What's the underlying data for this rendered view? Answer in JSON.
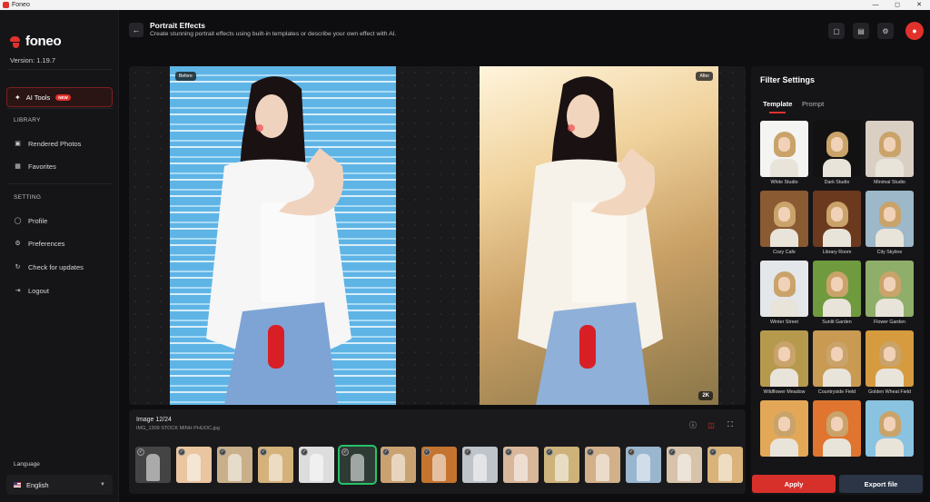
{
  "window": {
    "title": "Foneo"
  },
  "brand": {
    "name": "foneo",
    "version": "Version: 1.19.7",
    "accent": "#e0312c"
  },
  "sidebar": {
    "ai_tools": {
      "label": "AI Tools",
      "badge": "NEW",
      "icon": "magic-wand-icon"
    },
    "library_label": "LIBRARY",
    "library_items": [
      {
        "label": "Rendered Photos",
        "icon": "image-icon"
      },
      {
        "label": "Favorites",
        "icon": "grid-icon"
      }
    ],
    "setting_label": "SETTING",
    "setting_items": [
      {
        "label": "Profile",
        "icon": "user-circle-icon"
      },
      {
        "label": "Preferences",
        "icon": "gear-icon"
      },
      {
        "label": "Check for updates",
        "icon": "refresh-icon"
      },
      {
        "label": "Logout",
        "icon": "logout-icon"
      }
    ],
    "language_label": "Language",
    "language_value": "English"
  },
  "header": {
    "title": "Portrait Effects",
    "subtitle": "Create stunning portrait effects using built-in templates or describe your own effect with AI.",
    "icons": [
      "chat-icon",
      "file-icon",
      "settings-icon",
      "user-icon"
    ]
  },
  "preview": {
    "before_label": "Before",
    "after_label": "After",
    "resolution": "2K"
  },
  "strip": {
    "title": "Image 12/24",
    "filename": "IMG_1309 STOCK MINH PHUOC.jpg",
    "icons": [
      "info-icon",
      "compare-icon",
      "fullscreen-icon"
    ],
    "selected_index": 5,
    "thumbs": 15
  },
  "panel": {
    "title": "Filter Settings",
    "tabs": [
      "Template",
      "Prompt"
    ],
    "active_tab": "Template",
    "templates": [
      {
        "label": "White Studio",
        "bg": "#f4f4f2"
      },
      {
        "label": "Dark Studio",
        "bg": "#121212"
      },
      {
        "label": "Minimal Studio",
        "bg": "#d9cfc3"
      },
      {
        "label": "Cozy Cafe",
        "bg": "#8a5a33"
      },
      {
        "label": "Library Room",
        "bg": "#6b3a1e"
      },
      {
        "label": "City Skyline",
        "bg": "#9cb8c9"
      },
      {
        "label": "Winter Street",
        "bg": "#e3e7ea"
      },
      {
        "label": "Sunlit Garden",
        "bg": "#6f9a3e"
      },
      {
        "label": "Flower Garden",
        "bg": "#8fae6a"
      },
      {
        "label": "Wildflower Meadow",
        "bg": "#b59a4e"
      },
      {
        "label": "Countryside Field",
        "bg": "#c89a52"
      },
      {
        "label": "Golden Wheat Field",
        "bg": "#d69b3e"
      },
      {
        "label": "",
        "bg": "#e3a857"
      },
      {
        "label": "",
        "bg": "#e0752f"
      },
      {
        "label": "",
        "bg": "#89c3e0"
      }
    ]
  },
  "actions": {
    "apply": "Apply",
    "export": "Export file"
  }
}
